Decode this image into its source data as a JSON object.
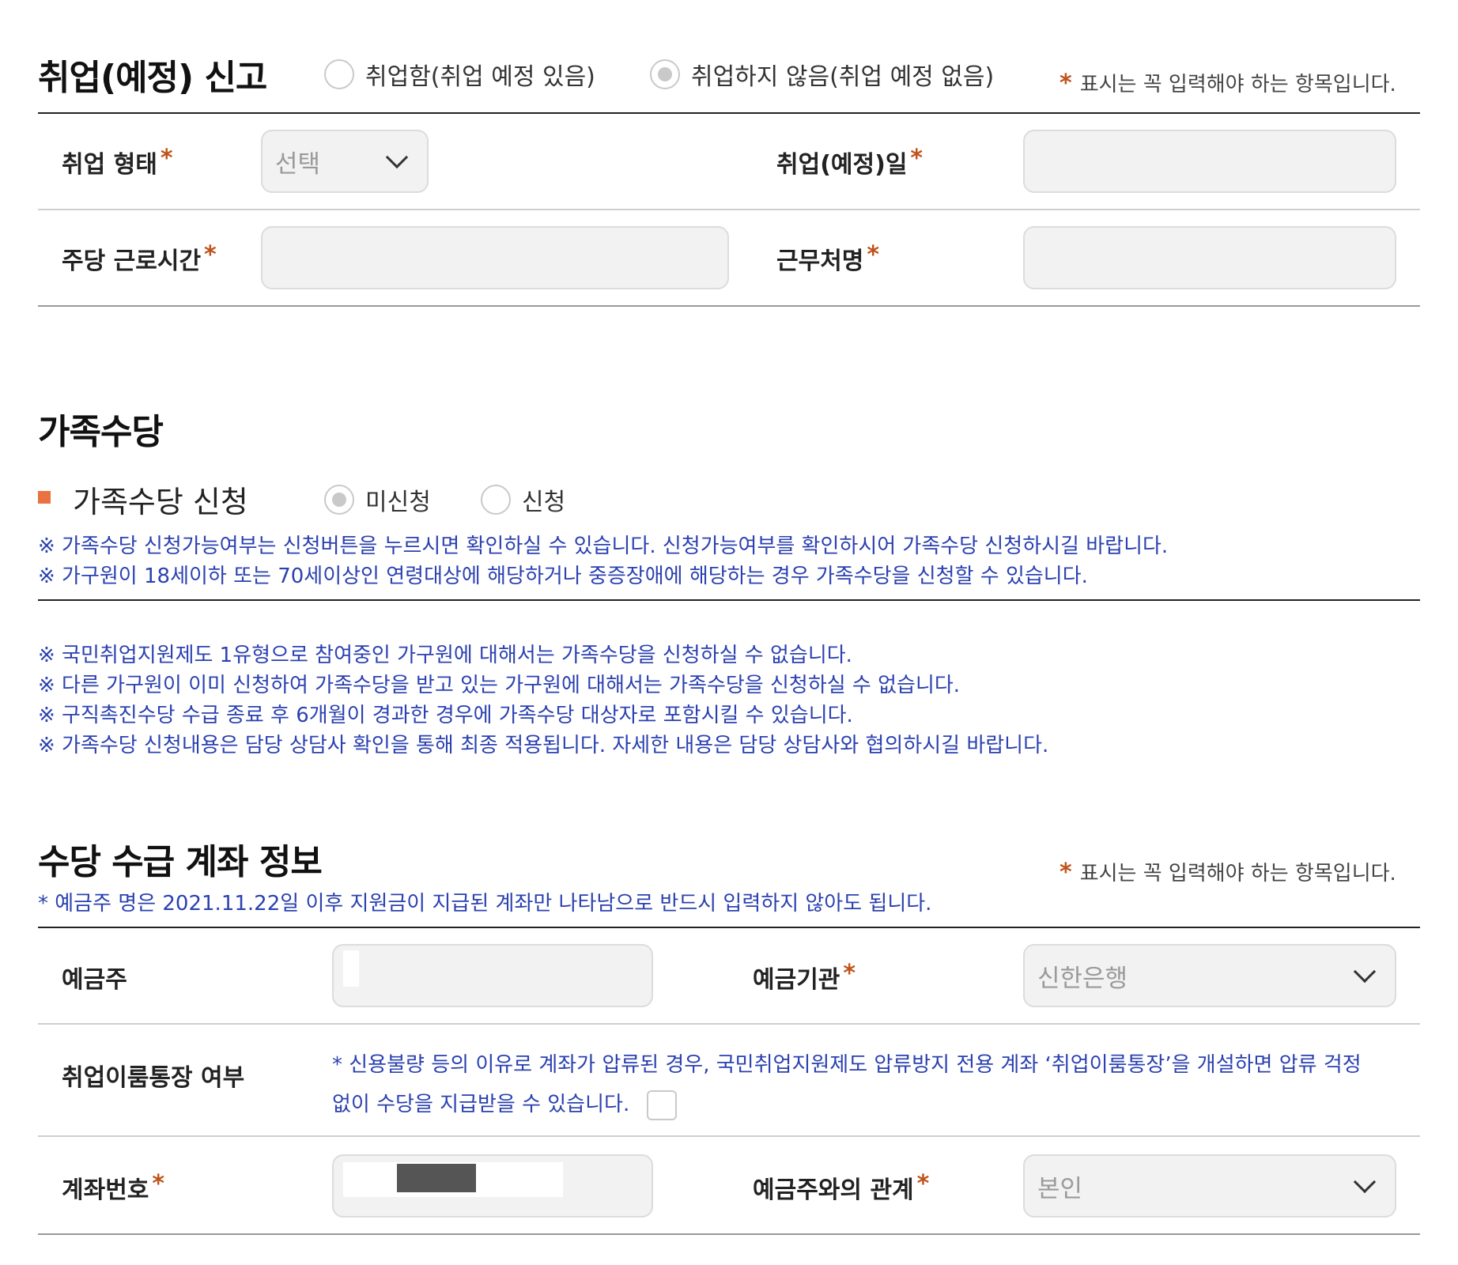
{
  "employment": {
    "title": "취업(예정) 신고",
    "radio_employed": "취업함(취업 예정 있음)",
    "radio_not_employed": "취업하지 않음(취업 예정 없음)",
    "selected": "not_employed",
    "required_star": "*",
    "required_note": "표시는 꼭 입력해야 하는 항목입니다.",
    "type_label": "취업 형태",
    "type_value": "선택",
    "date_label": "취업(예정)일",
    "date_value": "",
    "hours_label": "주당 근로시간",
    "hours_value": "",
    "workplace_label": "근무처명",
    "workplace_value": ""
  },
  "family": {
    "title": "가족수당",
    "sub_title": "가족수당 신청",
    "radio_not_applied": "미신청",
    "radio_applied": "신청",
    "selected": "not_applied",
    "notes_top": [
      "※ 가족수당 신청가능여부는 신청버튼을 누르시면 확인하실 수 있습니다. 신청가능여부를 확인하시어 가족수당 신청하시길 바랍니다.",
      "※ 가구원이 18세이하 또는 70세이상인 연령대상에 해당하거나 중증장애에 해당하는 경우 가족수당을 신청할 수 있습니다."
    ],
    "notes_bottom": [
      "※ 국민취업지원제도 1유형으로 참여중인 가구원에 대해서는 가족수당을 신청하실 수 없습니다.",
      "※ 다른 가구원이 이미 신청하여 가족수당을 받고 있는 가구원에 대해서는 가족수당을 신청하실 수 없습니다.",
      "※ 구직촉진수당 수급 종료 후 6개월이 경과한 경우에 가족수당 대상자로 포함시킬 수 있습니다.",
      "※ 가족수당 신청내용은 담당 상담사 확인을 통해 최종 적용됩니다. 자세한 내용은 담당 상담사와 협의하시길 바랍니다."
    ]
  },
  "account": {
    "title": "수당 수급 계좌 정보",
    "required_star": "*",
    "required_note": "표시는 꼭 입력해야 하는 항목입니다.",
    "holder_note": "* 예금주 명은 2021.11.22일 이후 지원금이 지급된 계좌만 나타남으로 반드시 입력하지 않아도 됩니다.",
    "holder_label": "예금주",
    "holder_value": "",
    "bank_label": "예금기관",
    "bank_value": "신한은행",
    "job_account_label": "취업이룸통장 여부",
    "job_account_note": "* 신용불량 등의 이유로 계좌가 압류된 경우, 국민취업지원제도 압류방지 전용 계좌 ‘취업이룸통장’을 개설하면 압류 걱정 없이 수당을 지급받을 수 있습니다.",
    "job_account_checked": false,
    "account_no_label": "계좌번호",
    "account_no_value": "",
    "relation_label": "예금주와의 관계",
    "relation_value": "본인"
  },
  "colors": {
    "required_star": "#c0531b",
    "note_blue": "#2b41b0",
    "sub_bullet": "#e8733f",
    "field_bg": "#f2f2f2"
  }
}
